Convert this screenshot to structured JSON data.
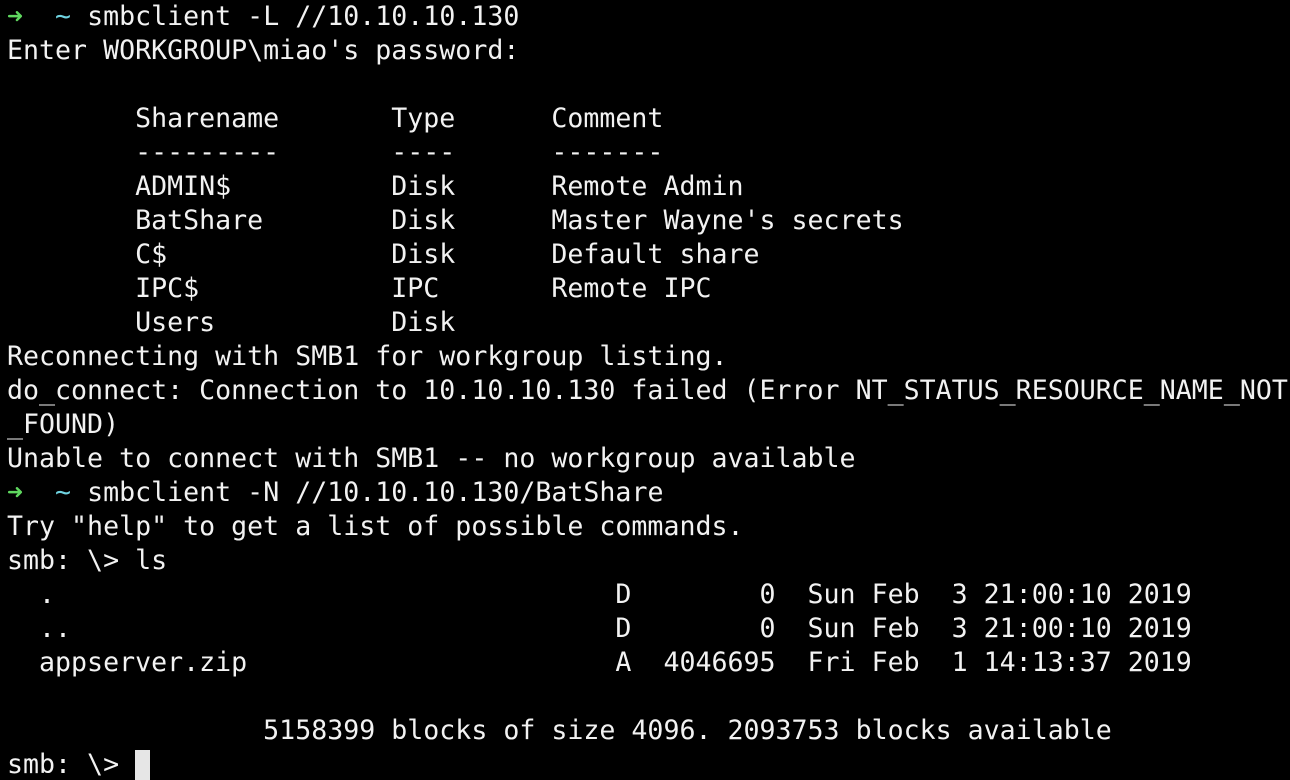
{
  "prompt": {
    "arrow": "➜",
    "tilde": "~"
  },
  "lines": {
    "cmd1": "smbclient -L //10.10.10.130",
    "pwd": "Enter WORKGROUP\\miao's password:",
    "blank1": "",
    "hdr": "        Sharename       Type      Comment",
    "sep": "        ---------       ----      -------",
    "share1": "        ADMIN$          Disk      Remote Admin",
    "share2": "        BatShare        Disk      Master Wayne's secrets",
    "share3": "        C$              Disk      Default share",
    "share4": "        IPC$            IPC       Remote IPC",
    "share5": "        Users           Disk",
    "reconnect": "Reconnecting with SMB1 for workgroup listing.",
    "err1": "do_connect: Connection to 10.10.10.130 failed (Error NT_STATUS_RESOURCE_NAME_NOT",
    "err2": "_FOUND)",
    "unable": "Unable to connect with SMB1 -- no workgroup available",
    "cmd2": "smbclient -N //10.10.10.130/BatShare",
    "tryhelp": "Try \"help\" to get a list of possible commands.",
    "smbls": "smb: \\> ls",
    "file1": "  .                                   D        0  Sun Feb  3 21:00:10 2019",
    "file2": "  ..                                  D        0  Sun Feb  3 21:00:10 2019",
    "file3": "  appserver.zip                       A  4046695  Fri Feb  1 14:13:37 2019",
    "blank2": "",
    "blocks": "                5158399 blocks of size 4096. 2093753 blocks available",
    "smbprompt": "smb: \\> "
  },
  "colors": {
    "background": "#000000",
    "text": "#f2f2f2",
    "arrow": "#5fd75f",
    "tilde": "#6fd3e0",
    "cursor": "#e6e6e6"
  }
}
